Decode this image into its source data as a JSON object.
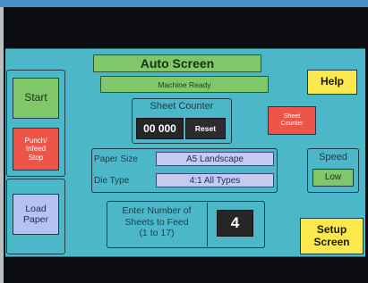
{
  "header": {
    "title": "Auto Screen",
    "status": "Machine Ready"
  },
  "left_panel": {
    "start_label": "Start",
    "punch_stop_label": "Punch/\nInfeed\nStop",
    "load_paper_label": "Load\nPaper"
  },
  "help_label": "Help",
  "sheet_counter": {
    "title": "Sheet Counter",
    "value": "00 000",
    "reset_label": "Reset",
    "toggle_label": "Sheet\nCounter"
  },
  "settings": {
    "paper_size_label": "Paper Size",
    "paper_size_value": "A5 Landscape",
    "die_type_label": "Die Type",
    "die_type_value": "4:1 All Types"
  },
  "speed": {
    "label": "Speed",
    "value": "Low"
  },
  "feed": {
    "prompt": "Enter Number of\nSheets to Feed\n(1 to 17)",
    "value": "4"
  },
  "setup_label": "Setup\nScreen",
  "colors": {
    "screen_bg": "#4bb7c9",
    "green": "#80c76a",
    "red": "#ee5548",
    "lavender": "#b6c2f0",
    "yellow": "#fbe84c"
  }
}
